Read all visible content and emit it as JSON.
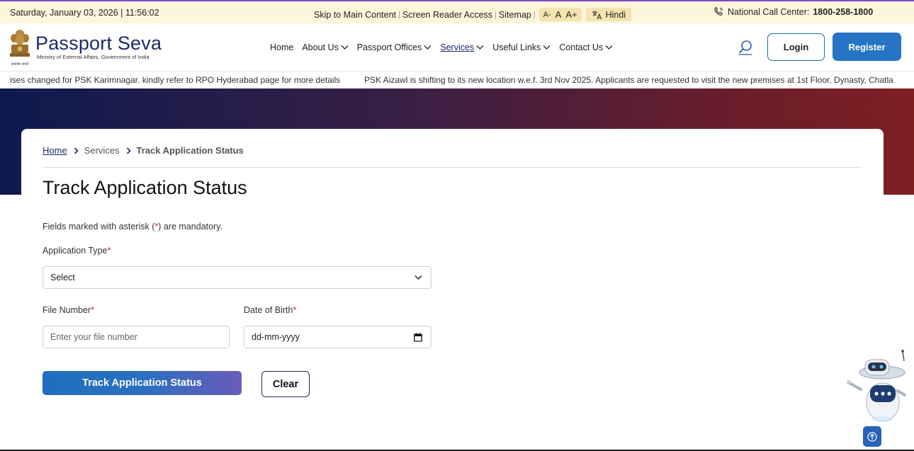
{
  "topbar": {
    "datetime": "Saturday, January 03, 2026 | 11:56:02",
    "skip_link": "Skip to Main Content",
    "screen_reader": "Screen Reader Access",
    "sitemap": "Sitemap",
    "font_small": "A-",
    "font_normal": "A",
    "font_large": "A+",
    "language": "Hindi",
    "call_label": "National Call Center:",
    "call_number": "1800-258-1800"
  },
  "header": {
    "brand_name": "Passport Seva",
    "brand_sub": "Ministry of External Affairs, Government of India",
    "nav": [
      {
        "label": "Home"
      },
      {
        "label": "About Us"
      },
      {
        "label": "Passport Offices"
      },
      {
        "label": "Services"
      },
      {
        "label": "Useful Links"
      },
      {
        "label": "Contact Us"
      }
    ],
    "login_label": "Login",
    "register_label": "Register"
  },
  "ticker": {
    "item1": "ises changed for PSK Karimnagar. kindly refer to RPO Hyderabad page for more details",
    "item2": "PSK Aizawl is shifting to its new location w.e.f. 3rd Nov 2025. Applicants are requested to visit the new premises at 1st Floor, Dynasty, Chatla"
  },
  "breadcrumb": {
    "home": "Home",
    "services": "Services",
    "current": "Track Application Status"
  },
  "page": {
    "title": "Track Application Status",
    "mandatory_pre": "Fields marked with asterisk (",
    "mandatory_star": "*",
    "mandatory_post": ") are mandatory."
  },
  "form": {
    "app_type_label": "Application Type",
    "app_type_value": "Select",
    "file_number_label": "File Number",
    "file_number_placeholder": "Enter your file number",
    "dob_label": "Date of Birth",
    "dob_placeholder": "dd-mm-yyyy",
    "required_mark": "*",
    "track_button": "Track Application Status",
    "clear_button": "Clear"
  },
  "colors": {
    "brand_navy": "#1d2a6b",
    "accent_blue": "#2674c5",
    "required_red": "#c62828",
    "topbar_bg": "#fdf5dc"
  },
  "icons": {
    "call": "phone-icon",
    "translate": "translate-icon",
    "search": "search-icon",
    "chevron": "chevron-down-icon",
    "breadcrumb_sep": "chevron-right-icon",
    "calendar": "calendar-icon",
    "chatbot": "chatbot-icon",
    "scroll_top": "arrow-up-icon"
  }
}
